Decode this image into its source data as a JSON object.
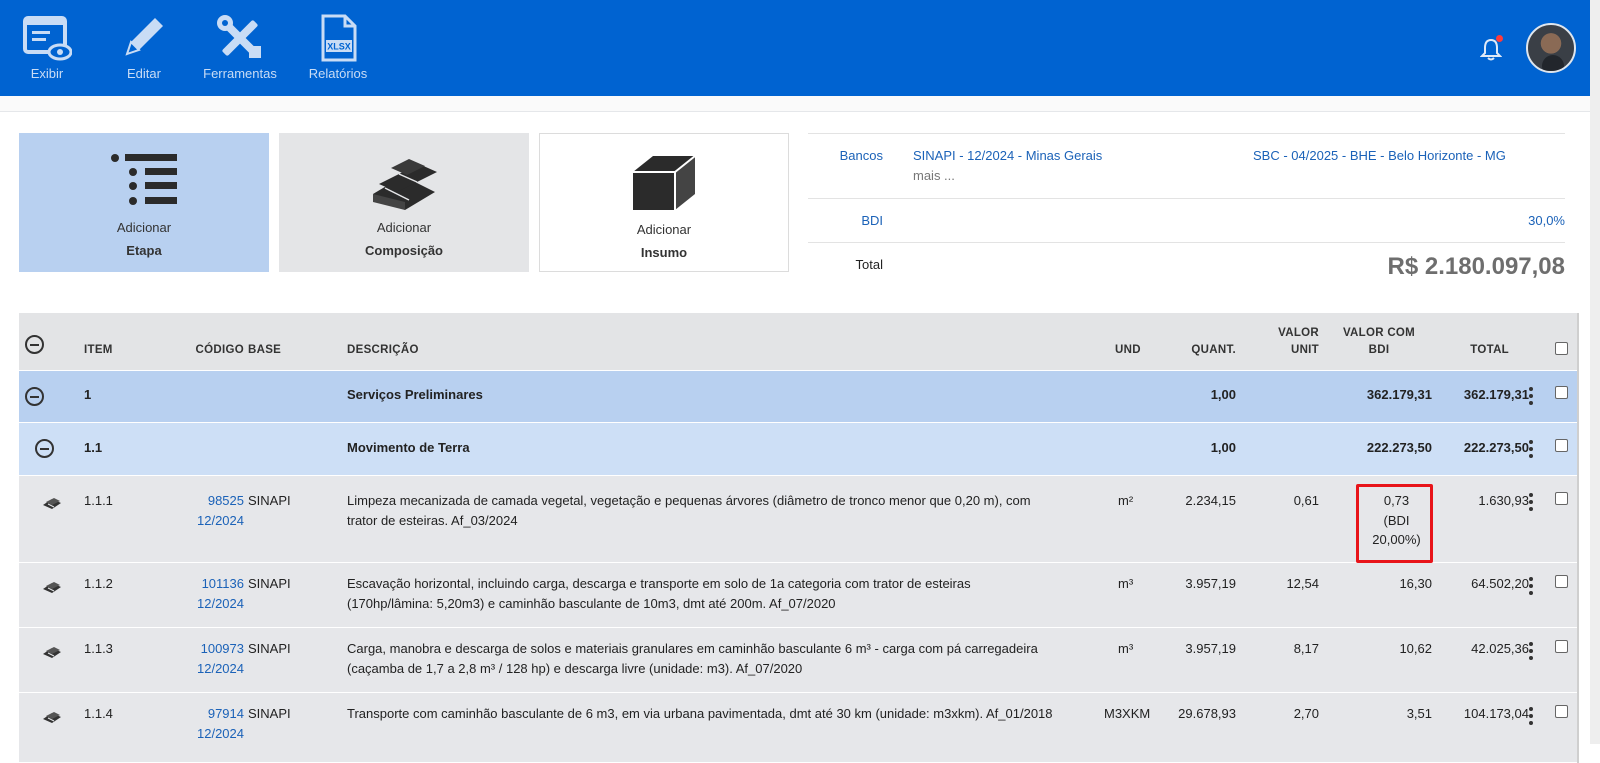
{
  "toolbar": {
    "items": [
      {
        "label": "Exibir",
        "icon": "view-list-icon"
      },
      {
        "label": "Editar",
        "icon": "pencil-icon"
      },
      {
        "label": "Ferramentas",
        "icon": "tools-icon"
      },
      {
        "label": "Relatórios",
        "icon": "xlsx-file-icon"
      }
    ],
    "xlsx_text": "XLSX"
  },
  "header": {
    "notification_icon": "bell-icon",
    "avatar": "user-avatar"
  },
  "cards": {
    "etapa": {
      "line1": "Adicionar",
      "line2": "Etapa"
    },
    "composicao": {
      "line1": "Adicionar",
      "line2": "Composição"
    },
    "insumo": {
      "line1": "Adicionar",
      "line2": "Insumo"
    }
  },
  "info": {
    "bancos_label": "Bancos",
    "banco1": "SINAPI - 12/2024 - Minas Gerais",
    "banco_mais": "mais ...",
    "banco2": "SBC - 04/2025 - BHE - Belo Horizonte - MG",
    "bdi_label": "BDI",
    "bdi_value": "30,0%",
    "total_label": "Total",
    "total_value": "R$ 2.180.097,08"
  },
  "table": {
    "headers": {
      "item": "ITEM",
      "codigo": "CÓDIGO",
      "base": "BASE",
      "descricao": "DESCRIÇÃO",
      "und": "UND",
      "quant": "QUANT.",
      "valor_unit_1": "VALOR",
      "valor_unit_2": "UNIT",
      "valor_bdi_1": "VALOR COM",
      "valor_bdi_2": "BDI",
      "total": "TOTAL"
    },
    "etapas": [
      {
        "item": "1",
        "descricao": "Serviços Preliminares",
        "quant": "1,00",
        "valor_bdi": "362.179,31",
        "total": "362.179,31"
      },
      {
        "item": "1.1",
        "descricao": "Movimento de Terra",
        "quant": "1,00",
        "valor_bdi": "222.273,50",
        "total": "222.273,50"
      }
    ],
    "rows": [
      {
        "item": "1.1.1",
        "codigo": "98525",
        "codigo_data": "12/2024",
        "base": "SINAPI",
        "desc1": "Limpeza mecanizada de camada vegetal, vegetação e pequenas árvores (diâmetro de tronco menor que 0,20 m), com",
        "desc2": "trator de esteiras. Af_03/2024",
        "und": "m²",
        "quant": "2.234,15",
        "valor_unit": "0,61",
        "valor_bdi": "0,73",
        "bdi_note1": "(BDI",
        "bdi_note2": "20,00%)",
        "total": "1.630,93"
      },
      {
        "item": "1.1.2",
        "codigo": "101136",
        "codigo_data": "12/2024",
        "base": "SINAPI",
        "desc1": "Escavação horizontal, incluindo carga, descarga e transporte em solo de 1a categoria com trator de esteiras",
        "desc2": "(170hp/lâmina: 5,20m3) e caminhão basculante de 10m3, dmt até 200m. Af_07/2020",
        "und": "m³",
        "quant": "3.957,19",
        "valor_unit": "12,54",
        "valor_bdi": "16,30",
        "total": "64.502,20"
      },
      {
        "item": "1.1.3",
        "codigo": "100973",
        "codigo_data": "12/2024",
        "base": "SINAPI",
        "desc1": "Carga, manobra e descarga de solos e materiais granulares em caminhão basculante 6 m³ - carga com pá carregadeira",
        "desc2": "(caçamba de 1,7 a 2,8 m³ / 128 hp) e descarga livre (unidade: m3). Af_07/2020",
        "und": "m³",
        "quant": "3.957,19",
        "valor_unit": "8,17",
        "valor_bdi": "10,62",
        "total": "42.025,36"
      },
      {
        "item": "1.1.4",
        "codigo": "97914",
        "codigo_data": "12/2024",
        "base": "SINAPI",
        "desc1": "Transporte com caminhão basculante de 6 m3, em via urbana pavimentada, dmt até 30 km (unidade: m3xkm). Af_01/2018",
        "desc2": "",
        "und": "M3XKM",
        "quant": "29.678,93",
        "valor_unit": "2,70",
        "valor_bdi": "3,51",
        "total": "104.173,04"
      }
    ]
  },
  "colors": {
    "topbar": "#0063d1",
    "etapa_row": "#b8d0f0",
    "subetapa_row": "#cddff6",
    "highlight": "#e8141a",
    "link": "#1b62b8"
  }
}
